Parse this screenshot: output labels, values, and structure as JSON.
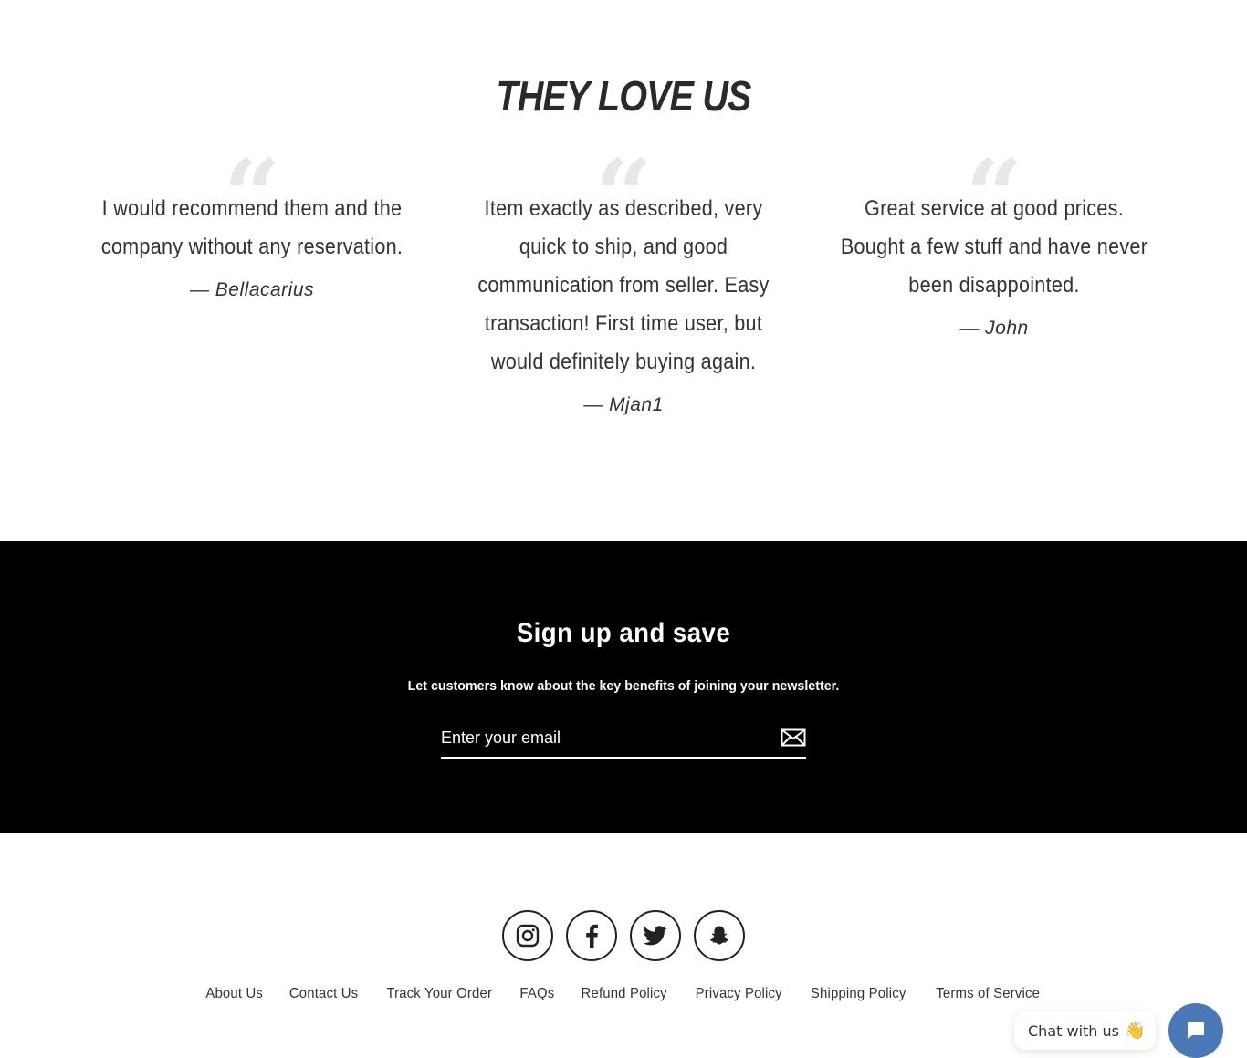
{
  "testimonials": {
    "title": "THEY LOVE US",
    "quote_mark": "“",
    "items": [
      {
        "text": "I would recommend them and the company without any reservation.",
        "author": "— Bellacarius"
      },
      {
        "text": "Item exactly as described, very quick to ship, and good communication from seller. Easy transaction! First time user, but would definitely buying again.",
        "author": "— Mjan1"
      },
      {
        "text": "Great service at good prices. Bought a few stuff and have never been disappointed.",
        "author": "— John"
      }
    ]
  },
  "newsletter": {
    "title": "Sign up and save",
    "subtitle": "Let customers know about the key benefits of joining your newsletter.",
    "email_placeholder": "Enter your email",
    "submit_icon": "envelope-icon"
  },
  "footer": {
    "social": [
      {
        "name": "instagram-icon"
      },
      {
        "name": "facebook-icon"
      },
      {
        "name": "twitter-icon"
      },
      {
        "name": "snapchat-icon"
      }
    ],
    "links": [
      "About Us",
      "Contact Us",
      "Track Your Order",
      "FAQs",
      "Refund Policy",
      "Privacy Policy",
      "Shipping Policy",
      "Terms of Service"
    ]
  },
  "chat": {
    "label": "Chat with us",
    "wave": "👋",
    "button_icon": "chat-icon",
    "button_color": "#4a78b8"
  }
}
